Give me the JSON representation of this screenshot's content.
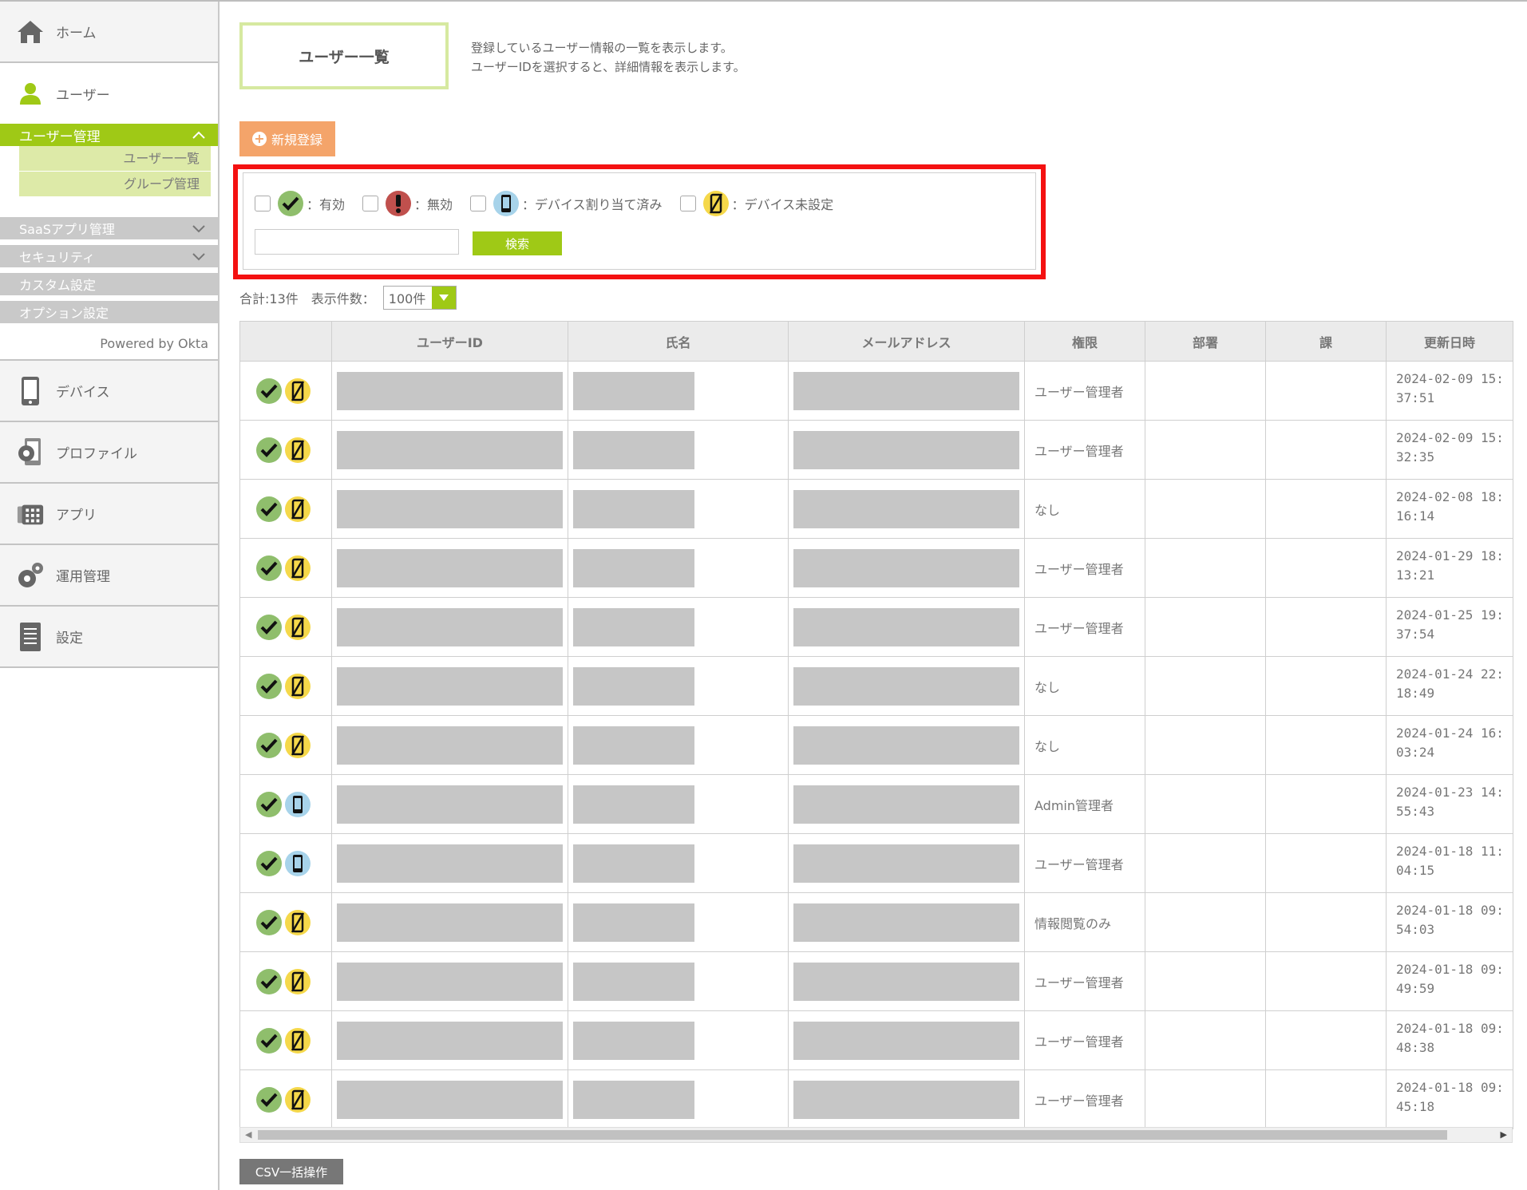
{
  "sidebar": {
    "home": "ホーム",
    "user": "ユーザー",
    "user_mgmt": "ユーザー管理",
    "user_list": "ユーザー一覧",
    "group_mgmt": "グループ管理",
    "saas": "SaaSアプリ管理",
    "security": "セキュリティ",
    "custom": "カスタム設定",
    "option": "オプション設定",
    "powered": "Powered by Okta",
    "device": "デバイス",
    "profile": "プロファイル",
    "app": "アプリ",
    "ops": "運用管理",
    "settings": "設定"
  },
  "page": {
    "title": "ユーザー一覧",
    "desc1": "登録しているユーザー情報の一覧を表示します。",
    "desc2": "ユーザーIDを選択すると、詳細情報を表示します。",
    "new_btn": "新規登録"
  },
  "filter": {
    "active": "：有効",
    "inactive": "：無効",
    "device_assigned": "：デバイス割り当て済み",
    "device_unset": "：デバイス未設定",
    "search_btn": "検索",
    "search_value": ""
  },
  "list": {
    "total": "合計:13件",
    "per_page_label": "表示件数：",
    "per_page": "100件"
  },
  "table": {
    "headers": [
      "",
      "ユーザーID",
      "氏名",
      "メールアドレス",
      "権限",
      "部署",
      "課",
      "更新日時"
    ],
    "rows": [
      {
        "device": "unset",
        "role": "ユーザー管理者",
        "date1": "2024-02-09 15:",
        "date2": "37:51"
      },
      {
        "device": "unset",
        "role": "ユーザー管理者",
        "date1": "2024-02-09 15:",
        "date2": "32:35"
      },
      {
        "device": "unset",
        "role": "なし",
        "date1": "2024-02-08 18:",
        "date2": "16:14"
      },
      {
        "device": "unset",
        "role": "ユーザー管理者",
        "date1": "2024-01-29 18:",
        "date2": "13:21"
      },
      {
        "device": "unset",
        "role": "ユーザー管理者",
        "date1": "2024-01-25 19:",
        "date2": "37:54"
      },
      {
        "device": "unset",
        "role": "なし",
        "date1": "2024-01-24 22:",
        "date2": "18:49"
      },
      {
        "device": "unset",
        "role": "なし",
        "date1": "2024-01-24 16:",
        "date2": "03:24"
      },
      {
        "device": "assigned",
        "role": "Admin管理者",
        "date1": "2024-01-23 14:",
        "date2": "55:43"
      },
      {
        "device": "assigned",
        "role": "ユーザー管理者",
        "date1": "2024-01-18 11:",
        "date2": "04:15"
      },
      {
        "device": "unset",
        "role": "情報閲覧のみ",
        "date1": "2024-01-18 09:",
        "date2": "54:03"
      },
      {
        "device": "unset",
        "role": "ユーザー管理者",
        "date1": "2024-01-18 09:",
        "date2": "49:59"
      },
      {
        "device": "unset",
        "role": "ユーザー管理者",
        "date1": "2024-01-18 09:",
        "date2": "48:38"
      },
      {
        "device": "unset",
        "role": "ユーザー管理者",
        "date1": "2024-01-18 09:",
        "date2": "45:18"
      }
    ]
  },
  "footer": {
    "csv_btn": "CSV一括操作"
  },
  "colors": {
    "accent_green": "#9fc916",
    "orange": "#f4a46a",
    "highlight_red": "#f41111"
  }
}
